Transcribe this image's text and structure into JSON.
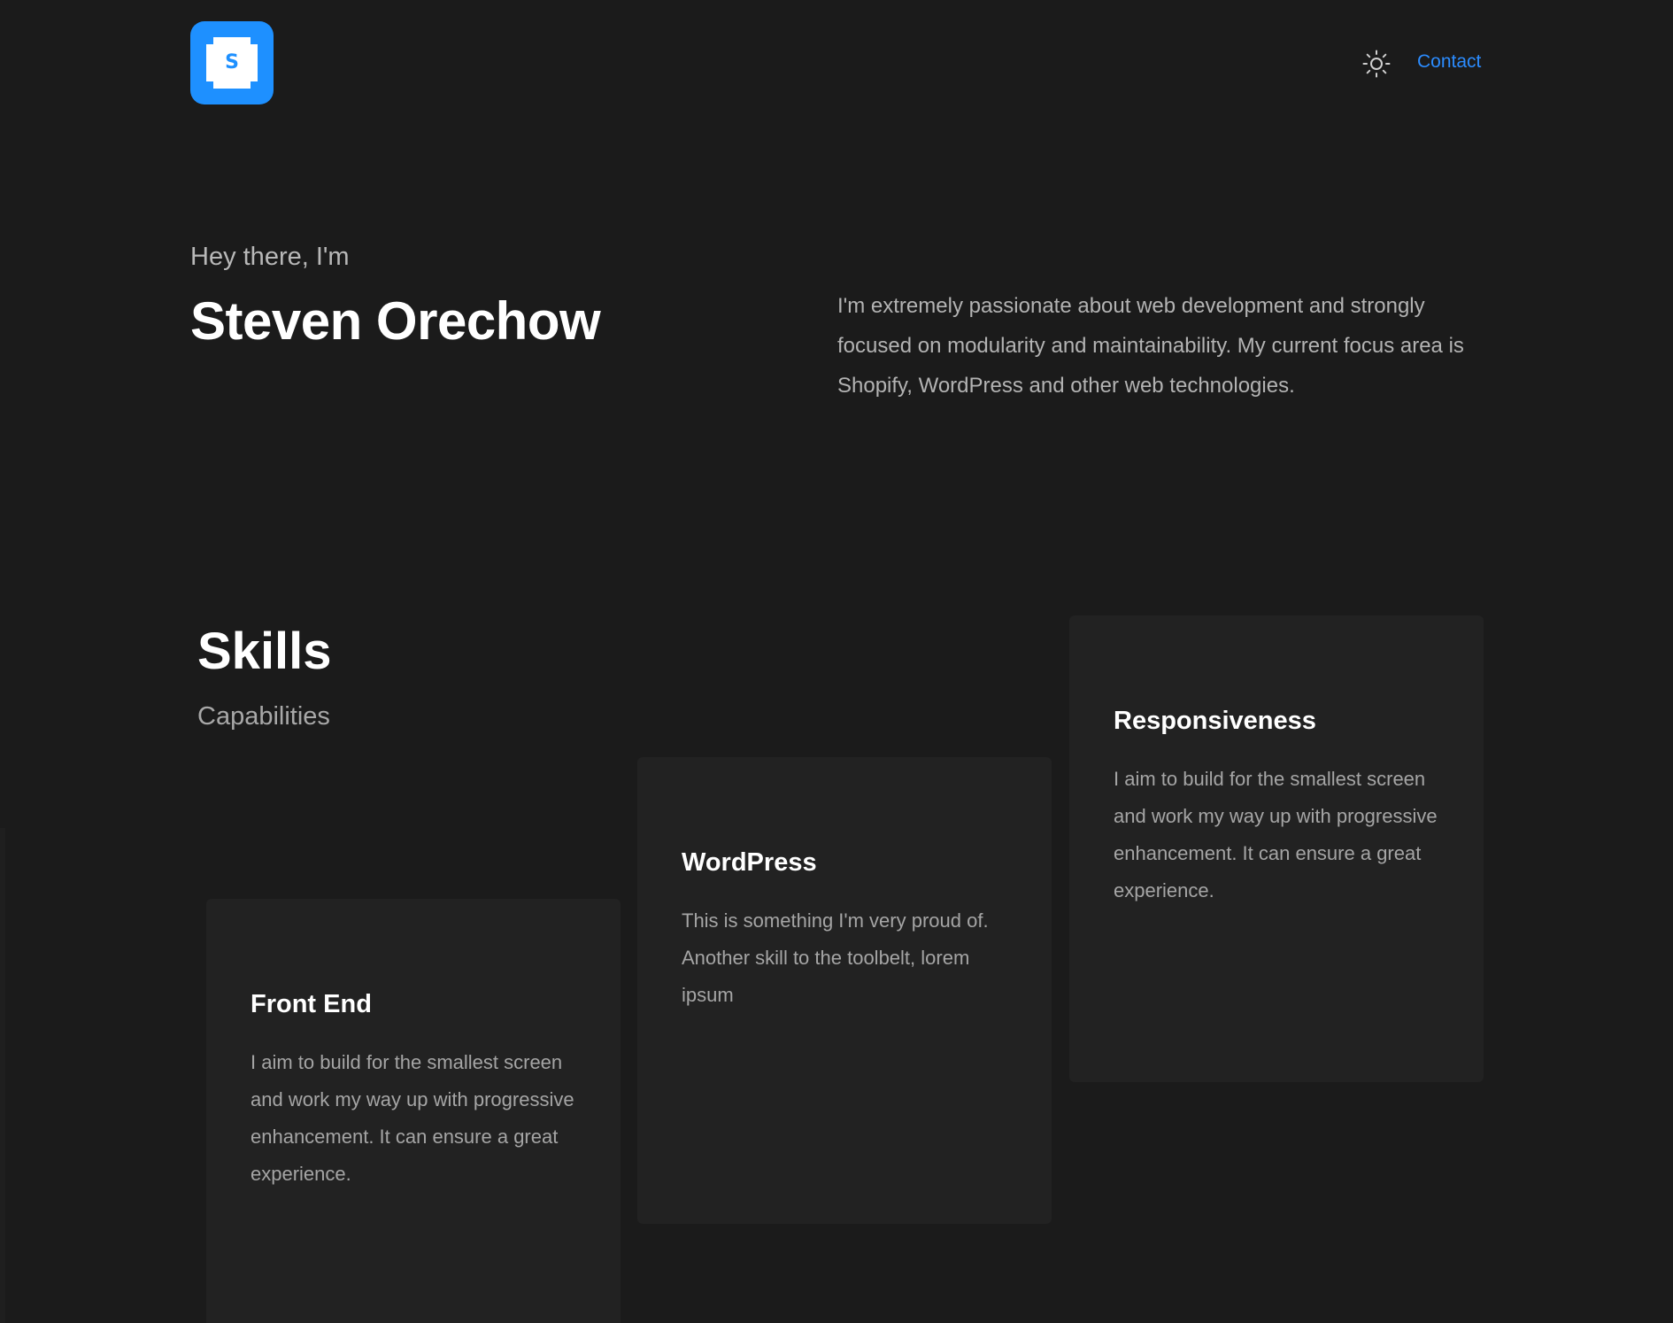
{
  "header": {
    "logo_letter": "S",
    "logo_icon": "logo-icon",
    "theme_icon": "sun-icon",
    "contact_label": "Contact"
  },
  "hero": {
    "greeting": "Hey there, I'm",
    "name": "Steven Orechow",
    "bio": "I'm extremely passionate about web development and strongly focused on modularity and maintainability. My current focus area is Shopify, WordPress and other web technologies."
  },
  "skills": {
    "title": "Skills",
    "subtitle": "Capabilities",
    "cards": [
      {
        "title": "Front End",
        "body": "I aim to build for the smallest screen and work my way up with progressive enhancement. It can ensure a great experience."
      },
      {
        "title": "WordPress",
        "body": "This is something I'm very proud of. Another skill to the toolbelt, lorem ipsum"
      },
      {
        "title": "Responsiveness",
        "body": "I aim to build for the smallest screen and work my way up with progressive enhancement. It can ensure a great experience."
      }
    ]
  },
  "colors": {
    "background": "#1b1b1b",
    "card": "#222222",
    "accent": "#1e90ff",
    "link": "#2b8cff"
  }
}
